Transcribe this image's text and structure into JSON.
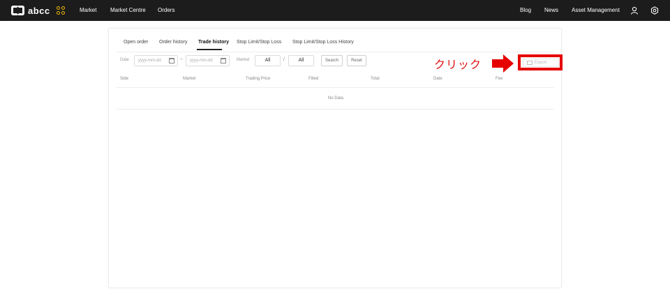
{
  "header": {
    "logo_text": "abcc",
    "nav_left": [
      "Market",
      "Market Centre",
      "Orders"
    ],
    "nav_right": [
      "Blog",
      "News",
      "Asset Management"
    ],
    "icons": [
      "apps-icon",
      "user-icon",
      "settings-icon"
    ]
  },
  "tabs": [
    {
      "label": "Open order",
      "active": false
    },
    {
      "label": "Order history",
      "active": false
    },
    {
      "label": "Trade history",
      "active": true
    },
    {
      "label": "Stop Limit/Stop Loss",
      "active": false
    },
    {
      "label": "Stop Limit/Stop Loss History",
      "active": false
    }
  ],
  "filters": {
    "date_label": "Date",
    "date_from_placeholder": "yyyy-mm-dd",
    "date_to_placeholder": "yyyy-mm-dd",
    "date_separator": "~",
    "market_label": "Market",
    "market_base": "All",
    "market_separator": "/",
    "market_quote": "All",
    "search_label": "Search",
    "reset_label": "Reset",
    "export_label": "Export"
  },
  "annotation": {
    "text": "クリック",
    "color": "#e60000"
  },
  "table": {
    "columns": [
      "Side",
      "Market",
      "Trading Price",
      "Filled",
      "Total",
      "Date",
      "Fee"
    ],
    "empty_text": "No Data"
  },
  "colors": {
    "topbar": "#1c1c1c",
    "accent": "#f0b90b",
    "annotation_red": "#e60000"
  }
}
